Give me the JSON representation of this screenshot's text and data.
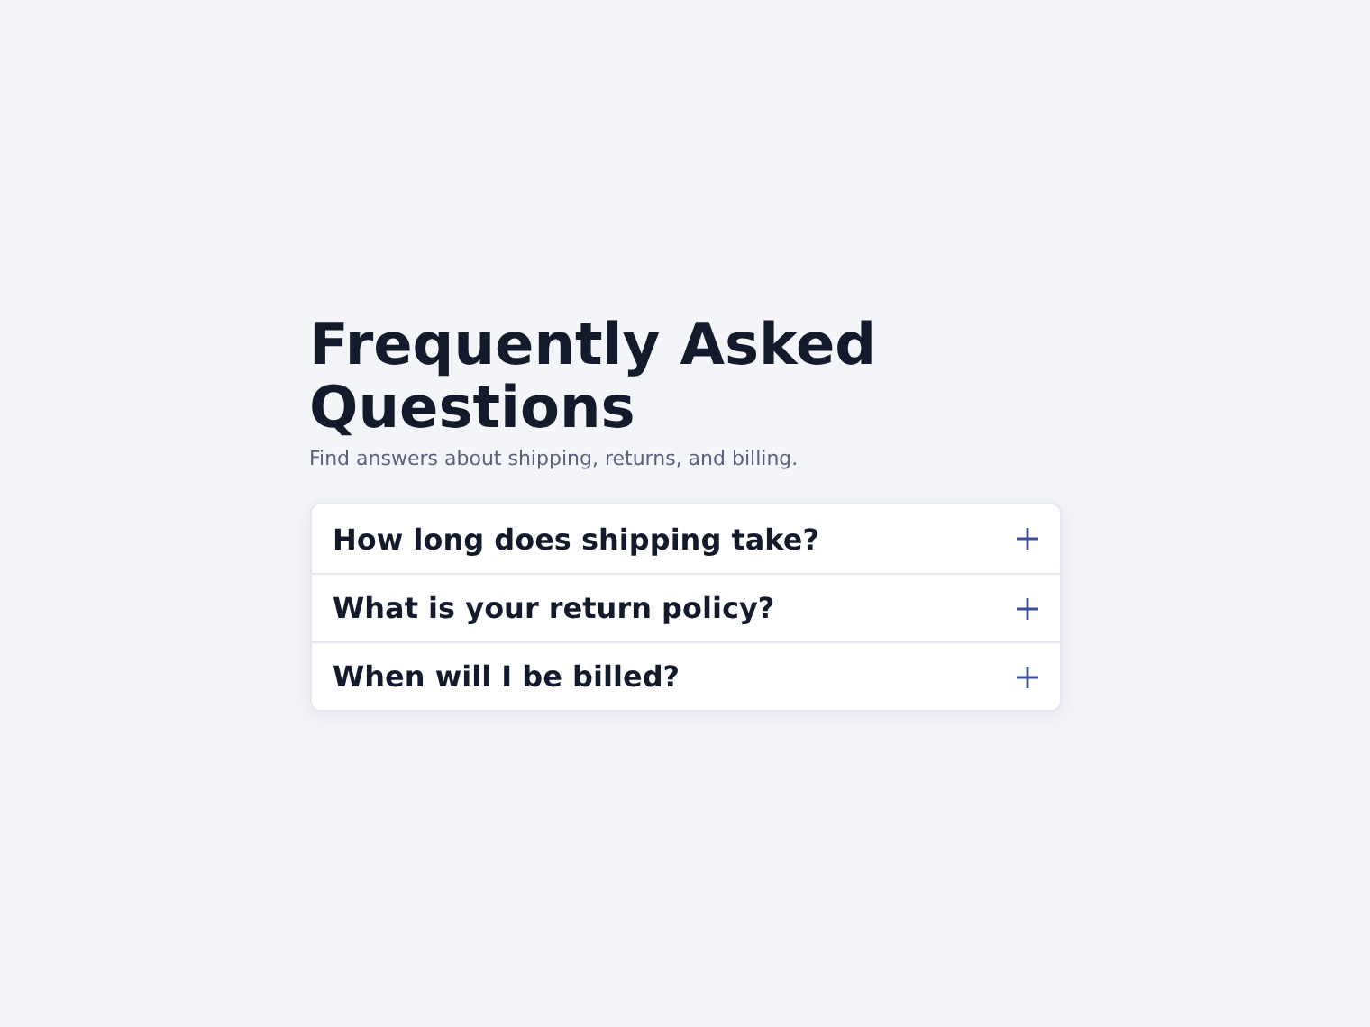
{
  "title": "Frequently Asked Questions",
  "subtitle": "Find answers about shipping, returns, and billing.",
  "faq_items": [
    {
      "question": "How long does shipping take?",
      "expanded": false
    },
    {
      "question": "What is your return policy?",
      "expanded": false
    },
    {
      "question": "When will I be billed?",
      "expanded": false
    }
  ]
}
